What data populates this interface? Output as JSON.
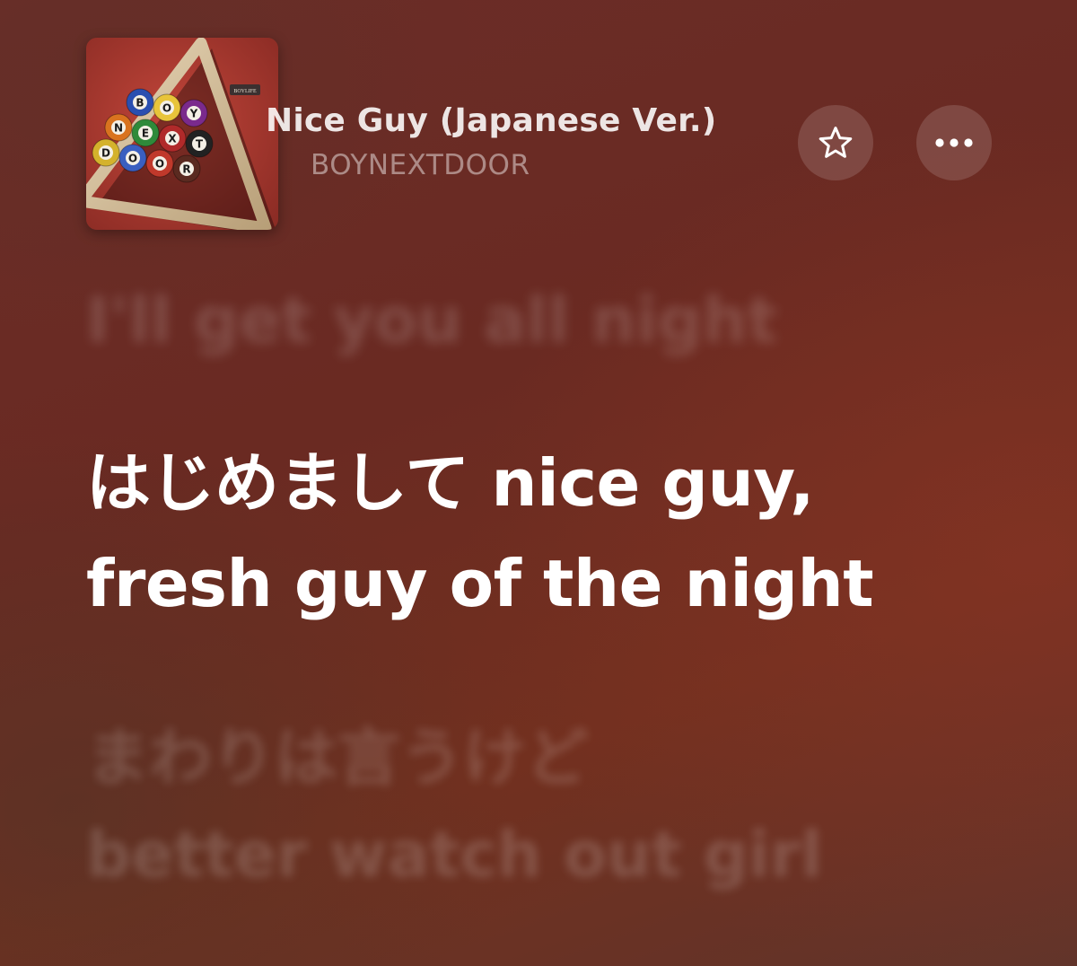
{
  "now_playing": {
    "title": "Nice Guy (Japanese Ver.)",
    "artist": "BOYNEXTDOOR",
    "artwork": {
      "label": "BOYLIFE",
      "ball_letters": [
        "B",
        "O",
        "Y",
        "N",
        "E",
        "X",
        "T",
        "D",
        "O",
        "O",
        "R"
      ]
    }
  },
  "controls": {
    "favorite_icon": "star-icon",
    "more_icon": "ellipsis-icon"
  },
  "lyrics": {
    "previous_line": "I'll get you all night",
    "current_line_1": "はじめまして nice guy,",
    "current_line_2": "fresh guy of the night",
    "next_line_1": "まわりは言うけど",
    "next_line_2": "better watch out girl"
  },
  "colors": {
    "background": "#6b2d28",
    "active_lyric": "#ffffff",
    "felt_red": "#b03a2e"
  }
}
